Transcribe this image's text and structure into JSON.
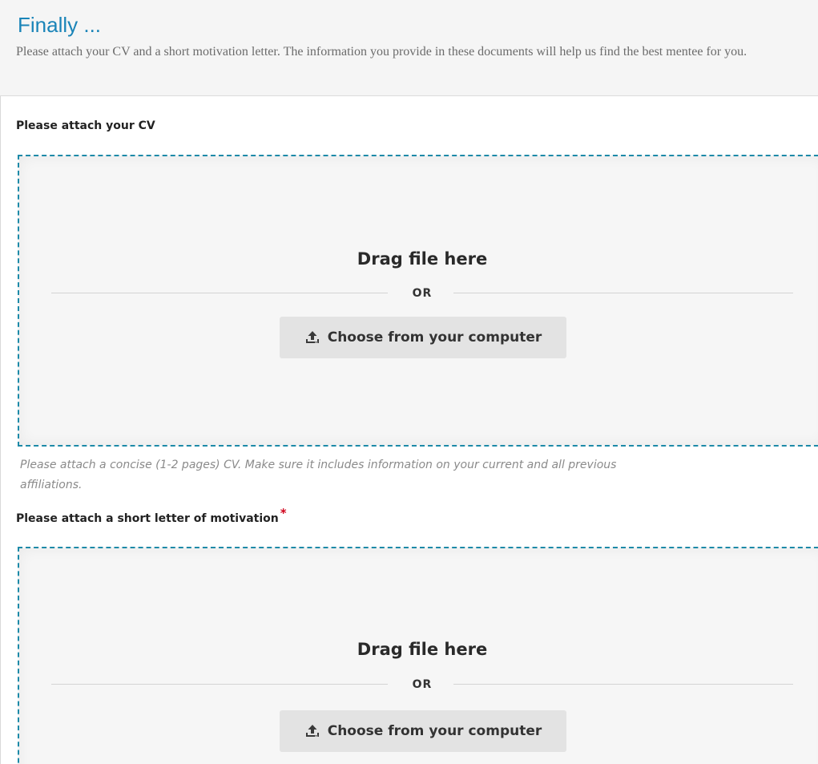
{
  "header": {
    "title": "Finally ...",
    "description": "Please attach your CV and a short motivation letter. The information you provide in these documents will help us find the best mentee for you."
  },
  "cv_field": {
    "label": "Please attach your CV",
    "dropzone": {
      "drag_text": "Drag file here",
      "or_text": "OR",
      "button_label": "Choose from your computer",
      "button_icon": "upload-icon"
    },
    "help_text": "Please attach a concise (1-2 pages) CV. Make sure it includes information on your current and all previous affiliations."
  },
  "motivation_field": {
    "label": "Please attach a short letter of motivation",
    "required_marker": "*",
    "dropzone": {
      "drag_text": "Drag file here",
      "or_text": "OR",
      "button_label": "Choose from your computer",
      "button_icon": "upload-icon"
    }
  },
  "colors": {
    "accent": "#1a84b8",
    "dropzone_border": "#1d8aa8",
    "required": "#d0021b"
  }
}
